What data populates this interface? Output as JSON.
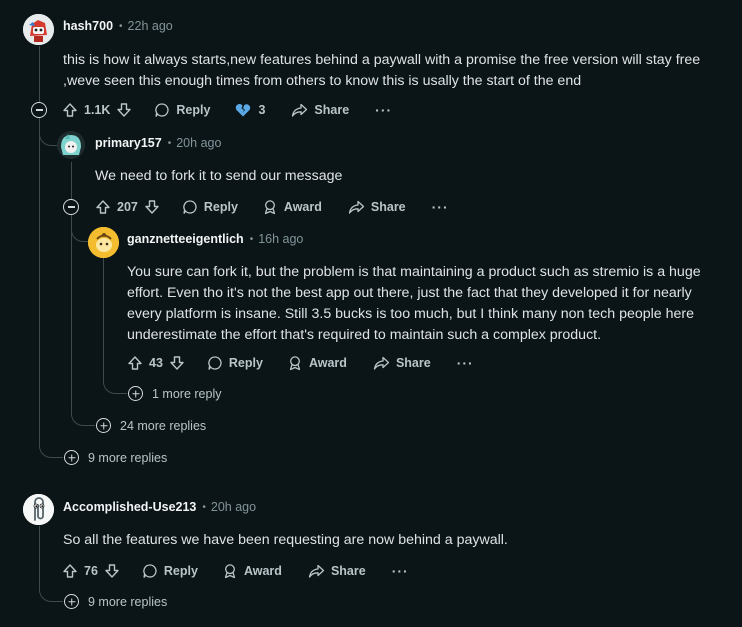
{
  "comments": [
    {
      "author": "hash700",
      "time": "22h ago",
      "body": "this is how it always starts,new features behind a paywall with a promise the free version will stay free ,weve seen this enough times from others to know this is usally the start of the end",
      "votes": "1.1K",
      "reply_label": "Reply",
      "award_count": "3",
      "share_label": "Share",
      "more_label": "···",
      "avatar_icon": "snoo-red-avatar",
      "replies": [
        {
          "author": "primary157",
          "time": "20h ago",
          "body": "We need to fork it to send our message",
          "votes": "207",
          "reply_label": "Reply",
          "award_label": "Award",
          "share_label": "Share",
          "more_label": "···",
          "avatar_icon": "anime-avatar",
          "replies": [
            {
              "author": "ganznetteeigentlich",
              "time": "16h ago",
              "body": "You sure can fork it, but the problem is that maintaining a product such as stremio is a huge effort. Even tho it's not the best app out there, just the fact that they developed it for nearly every platform is insane. Still 3.5 bucks is too much, but I think many non tech people here underestimate the effort that's required to maintain such a complex product.",
              "votes": "43",
              "reply_label": "Reply",
              "award_label": "Award",
              "share_label": "Share",
              "more_label": "···",
              "avatar_icon": "yellow-snoo-avatar",
              "more_replies": "1 more reply"
            }
          ],
          "more_replies": "24 more replies"
        }
      ],
      "more_replies": "9 more replies"
    },
    {
      "author": "Accomplished-Use213",
      "time": "20h ago",
      "body": "So all the features we have been requesting are now behind a paywall.",
      "votes": "76",
      "reply_label": "Reply",
      "award_label": "Award",
      "share_label": "Share",
      "more_label": "···",
      "avatar_icon": "clippy-avatar",
      "more_replies": "9 more replies"
    }
  ],
  "separator": "•",
  "colors": {
    "background": "#0b1416",
    "text": "#d7dadc",
    "muted": "#82959b",
    "thread_line": "#3d4a4d",
    "heart": "#5aa9e6"
  }
}
